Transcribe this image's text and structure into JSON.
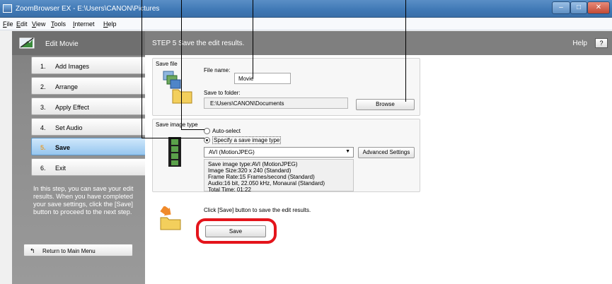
{
  "window": {
    "title": "ZoomBrowser EX - E:\\Users\\CANON\\Pictures",
    "buttons": {
      "minimize": "–",
      "maximize": "□",
      "close": "✕"
    }
  },
  "menu": [
    "File",
    "Edit",
    "View",
    "Tools",
    "Internet",
    "Help"
  ],
  "sidebar": {
    "title": "Edit Movie",
    "steps": [
      {
        "num": "1.",
        "label": "Add Images"
      },
      {
        "num": "2.",
        "label": "Arrange"
      },
      {
        "num": "3.",
        "label": "Apply Effect"
      },
      {
        "num": "4.",
        "label": "Set Audio"
      },
      {
        "num": "5.",
        "label": "Save"
      },
      {
        "num": "6.",
        "label": "Exit"
      }
    ],
    "active_step": 5,
    "help_text": "In this step, you can save your edit results. When you have completed your save settings, click the [Save] button to proceed to the next step.",
    "return_label": "Return to Main Menu"
  },
  "main": {
    "step_title": "STEP 5 Save the edit results.",
    "help_label": "Help",
    "help_button": "?",
    "save_file": {
      "group_title": "Save file",
      "file_name_label": "File name:",
      "file_name_value": "Movie",
      "folder_label": "Save to folder:",
      "folder_value": "E:\\Users\\CANON\\Documents",
      "browse_label": "Browse"
    },
    "save_image_type": {
      "group_title": "Save image type",
      "option_auto": "Auto-select",
      "option_specify": "Specify a save image type",
      "selected_option": "Specify a save image type",
      "format_value": "AVI (MotionJPEG)",
      "advanced_label": "Advanced Settings",
      "info_lines": [
        "Save image type:AVI (MotionJPEG)",
        "Image Size:320 x 240 (Standard)",
        "Frame Rate:15 Frames/second (Standard)",
        "Audio:16 bit, 22.050 kHz, Monaural (Standard)",
        "Total Time: 01:22"
      ]
    },
    "instruction": "Click [Save] button to save the edit results.",
    "save_button": "Save"
  },
  "colors": {
    "highlight_ring": "#e4141b",
    "titlebar": "#3f78b5",
    "sidebar": "#8c8c8c",
    "active_step": "#96c6ef"
  }
}
